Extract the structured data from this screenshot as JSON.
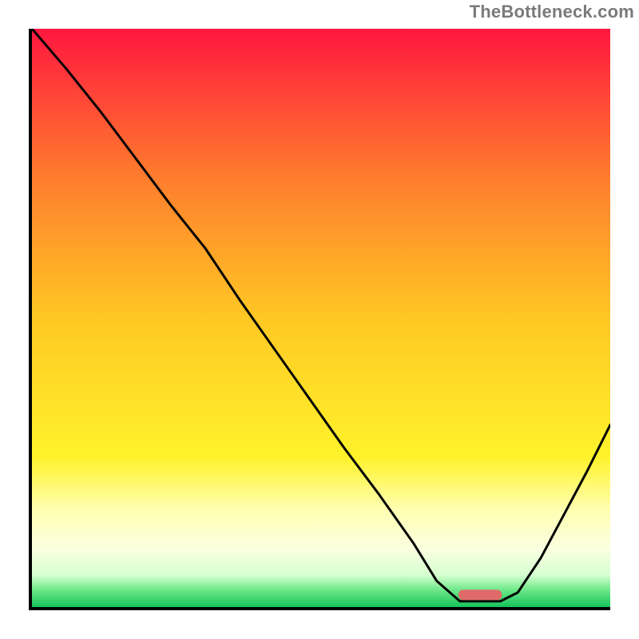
{
  "watermark": "TheBottleneck.com",
  "chart_data": {
    "type": "line",
    "title": "",
    "xlabel": "",
    "ylabel": "",
    "xlim": [
      0,
      1
    ],
    "ylim": [
      0,
      1
    ],
    "grid": false,
    "gradient_stops": [
      {
        "offset": 0.0,
        "color": "#ff173f"
      },
      {
        "offset": 0.25,
        "color": "#ff7a2e"
      },
      {
        "offset": 0.5,
        "color": "#ffc824"
      },
      {
        "offset": 0.74,
        "color": "#fff22a"
      },
      {
        "offset": 0.83,
        "color": "#ffffb0"
      },
      {
        "offset": 0.9,
        "color": "#faffe0"
      },
      {
        "offset": 0.945,
        "color": "#d6ffd0"
      },
      {
        "offset": 0.97,
        "color": "#70e88a"
      },
      {
        "offset": 1.0,
        "color": "#14c45a"
      }
    ],
    "series": [
      {
        "name": "curve",
        "color": "#000000",
        "x": [
          0.0,
          0.06,
          0.12,
          0.18,
          0.24,
          0.3,
          0.36,
          0.42,
          0.48,
          0.54,
          0.6,
          0.66,
          0.7,
          0.74,
          0.81,
          0.84,
          0.88,
          0.92,
          0.96,
          1.0
        ],
        "y": [
          1.0,
          0.93,
          0.855,
          0.775,
          0.695,
          0.62,
          0.53,
          0.445,
          0.36,
          0.275,
          0.195,
          0.11,
          0.045,
          0.01,
          0.01,
          0.025,
          0.085,
          0.16,
          0.235,
          0.315
        ]
      }
    ],
    "marker": {
      "name": "target-band",
      "x_center": 0.775,
      "width": 0.075,
      "y": 0.012,
      "height": 0.018,
      "color": "#e06a6a"
    }
  }
}
